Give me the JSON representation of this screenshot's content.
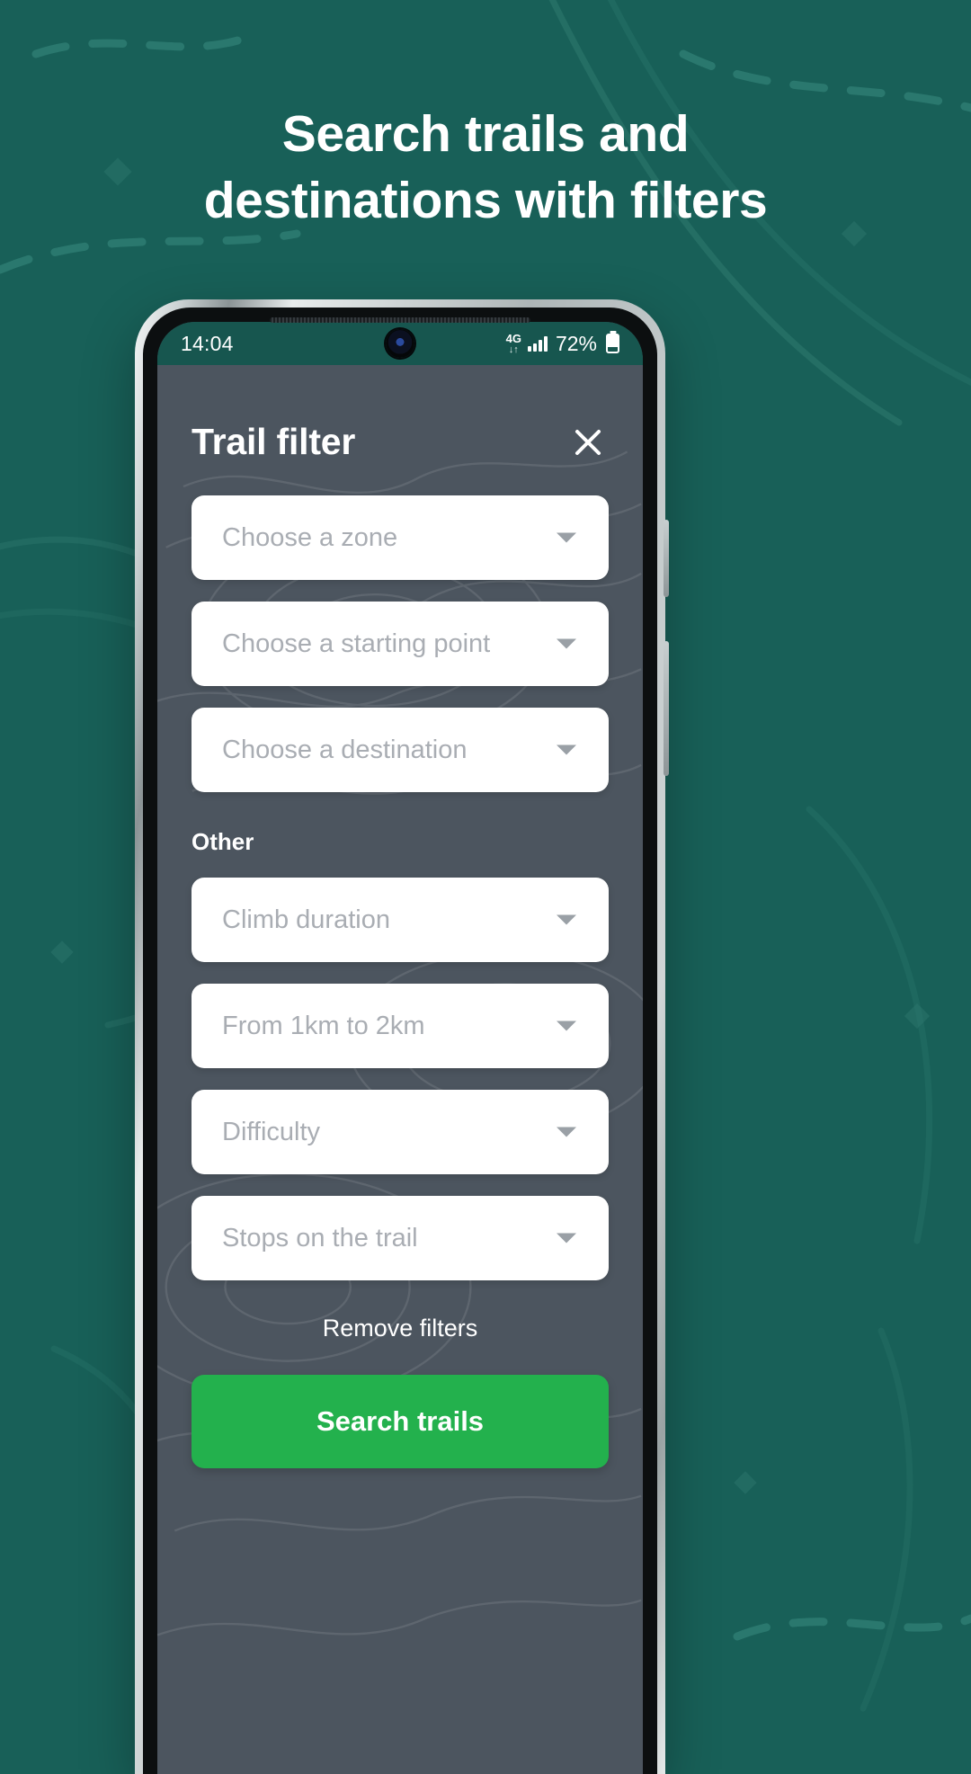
{
  "promo": {
    "headline_line1": "Search trails and",
    "headline_line2": "destinations with filters",
    "background_color": "#186058"
  },
  "status_bar": {
    "time": "14:04",
    "network_type": "4G",
    "data_arrows": "↓↑",
    "battery_percent": "72%",
    "signal_icon": "signal-bars-icon",
    "battery_icon": "battery-icon",
    "camera_icon": "front-camera-punch-hole"
  },
  "screen": {
    "title": "Trail filter",
    "close_icon": "close-icon",
    "section_other_label": "Other",
    "primary_fields": [
      {
        "placeholder": "Choose a zone",
        "name": "zone"
      },
      {
        "placeholder": "Choose a starting point",
        "name": "starting-point"
      },
      {
        "placeholder": "Choose a destination",
        "name": "destination"
      }
    ],
    "other_fields": [
      {
        "placeholder": "Climb duration",
        "name": "climb-duration"
      },
      {
        "placeholder": "From 1km to 2km",
        "name": "distance-range"
      },
      {
        "placeholder": "Difficulty",
        "name": "difficulty"
      },
      {
        "placeholder": "Stops on the trail",
        "name": "stops-on-trail"
      }
    ],
    "remove_filters_label": "Remove filters",
    "search_button_label": "Search trails",
    "accent_green": "#23b14d",
    "sheet_background": "#4c555f",
    "dropdown_caret_icon": "chevron-down-icon"
  }
}
